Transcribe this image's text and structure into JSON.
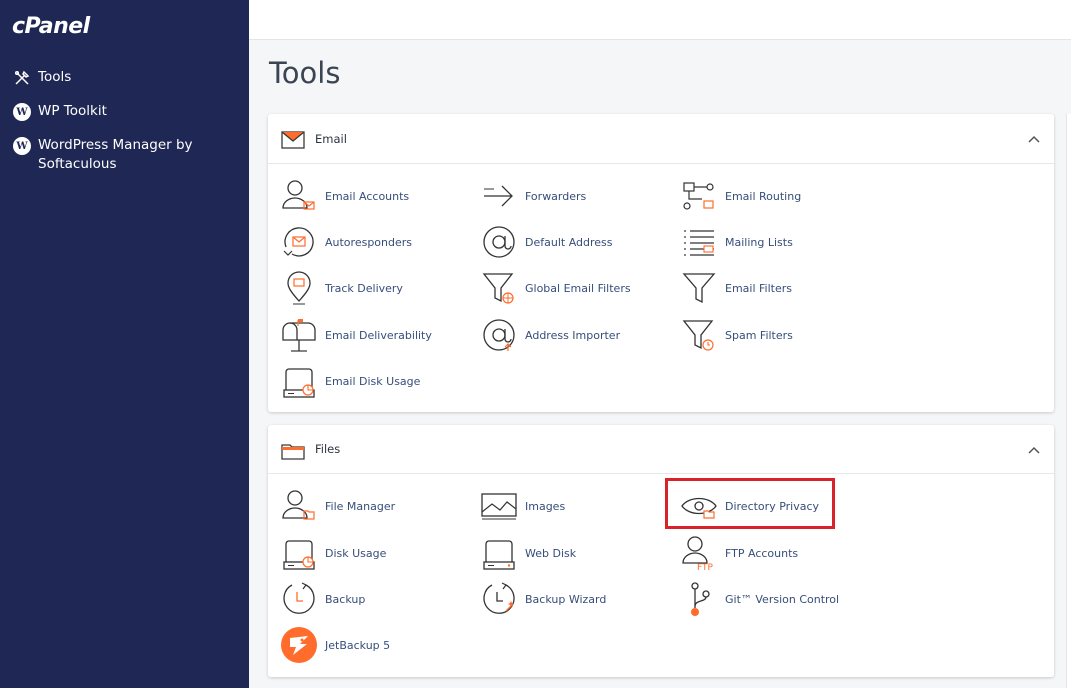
{
  "sidebar": {
    "logo": "cPanel",
    "items": [
      {
        "label": "Tools",
        "icon": "tools-icon"
      },
      {
        "label": "WP Toolkit",
        "icon": "wordpress-icon"
      },
      {
        "label": "WordPress Manager by Softaculous",
        "icon": "wordpress-icon"
      }
    ]
  },
  "page": {
    "title": "Tools"
  },
  "sections": {
    "email": {
      "title": "Email",
      "tools": [
        "Email Accounts",
        "Forwarders",
        "Email Routing",
        "Autoresponders",
        "Default Address",
        "Mailing Lists",
        "Track Delivery",
        "Global Email Filters",
        "Email Filters",
        "Email Deliverability",
        "Address Importer",
        "Spam Filters",
        "Email Disk Usage"
      ]
    },
    "files": {
      "title": "Files",
      "tools": [
        "File Manager",
        "Images",
        "Directory Privacy",
        "Disk Usage",
        "Web Disk",
        "FTP Accounts",
        "Backup",
        "Backup Wizard",
        "Git™ Version Control",
        "JetBackup 5"
      ]
    }
  },
  "colors": {
    "sidebar_bg": "#1f2855",
    "accent_orange": "#ff6c2c",
    "highlight_red": "#d9232b",
    "link_blue": "#364e7a"
  }
}
